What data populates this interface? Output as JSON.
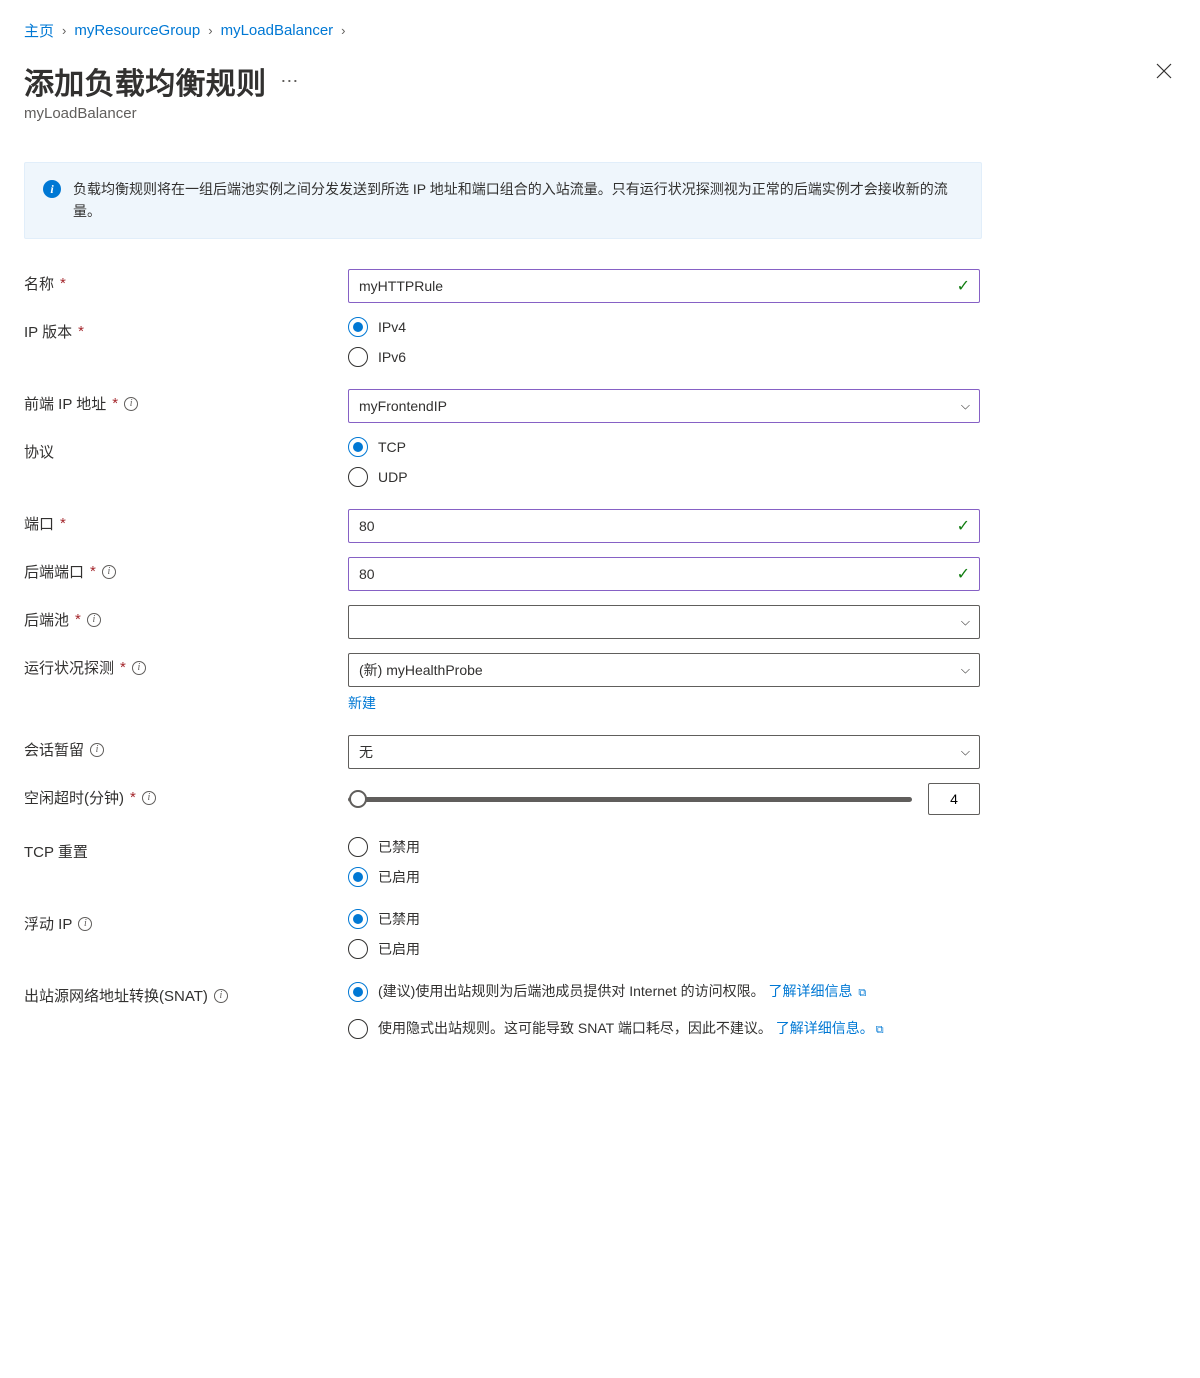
{
  "breadcrumb": {
    "home": "主页",
    "rg": "myResourceGroup",
    "lb": "myLoadBalancer"
  },
  "header": {
    "title": "添加负载均衡规则",
    "subtitle": "myLoadBalancer"
  },
  "banner": {
    "text": "负载均衡规则将在一组后端池实例之间分发发送到所选 IP 地址和端口组合的入站流量。只有运行状况探测视为正常的后端实例才会接收新的流量。"
  },
  "fields": {
    "name": {
      "label": "名称",
      "value": "myHTTPRule"
    },
    "ip_version": {
      "label": "IP 版本",
      "options": {
        "v4": "IPv4",
        "v6": "IPv6"
      },
      "selected": "v4"
    },
    "frontend_ip": {
      "label": "前端 IP 地址",
      "value": "myFrontendIP"
    },
    "protocol": {
      "label": "协议",
      "options": {
        "tcp": "TCP",
        "udp": "UDP"
      },
      "selected": "tcp"
    },
    "port": {
      "label": "端口",
      "value": "80"
    },
    "backend_port": {
      "label": "后端端口",
      "value": "80"
    },
    "backend_pool": {
      "label": "后端池",
      "value": ""
    },
    "health_probe": {
      "label": "运行状况探测",
      "value": "(新) myHealthProbe",
      "new_link": "新建"
    },
    "session_persist": {
      "label": "会话暂留",
      "value": "无"
    },
    "idle_timeout": {
      "label": "空闲超时(分钟)",
      "value": "4"
    },
    "tcp_reset": {
      "label": "TCP 重置",
      "options": {
        "disabled": "已禁用",
        "enabled": "已启用"
      },
      "selected": "enabled"
    },
    "floating_ip": {
      "label": "浮动 IP",
      "options": {
        "disabled": "已禁用",
        "enabled": "已启用"
      },
      "selected": "disabled"
    },
    "snat": {
      "label": "出站源网络地址转换(SNAT)",
      "options": {
        "recommended_pre": "(建议)使用出站规则为后端池成员提供对 Internet 的访问权限。",
        "implicit_pre": "使用隐式出站规则。这可能导致 SNAT 端口耗尽，因此不建议。",
        "learn_more": "了解详细信息"
      },
      "selected": "recommended"
    }
  }
}
